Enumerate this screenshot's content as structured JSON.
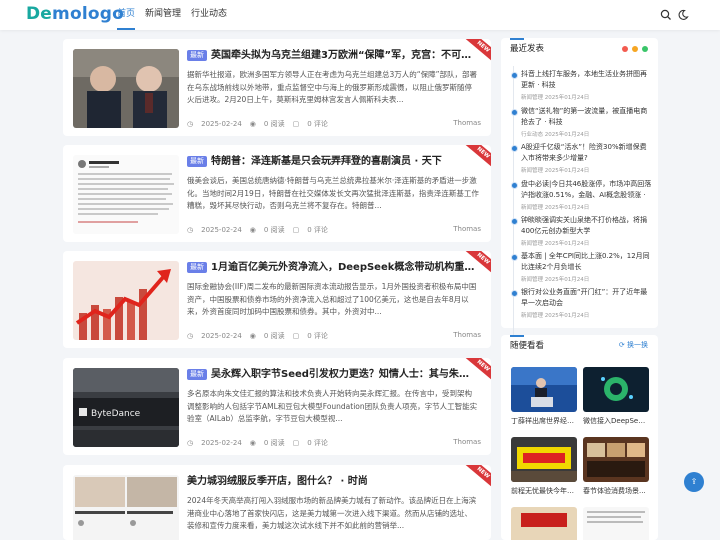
{
  "header": {
    "logo": {
      "part1": "De",
      "part2": "mologo"
    },
    "nav": [
      "首页",
      "新闻管理",
      "行业动态"
    ]
  },
  "posts": [
    {
      "badge": "最新",
      "title": "英国牵头拟为乌克兰组建3万欧洲“保障”军，克宫：不可接受 · 天下",
      "excerpt": "据新华社报道，欧洲多国军方领导人正在考虑为乌克兰组建总3万人的“保障”部队，部署在乌东战场前线以外地带，重点监督空中与海上的俄罗斯形成震慑，以阻止俄罗斯随停火后进攻。2月20日上午，莫斯科克里姆林宫发言人佩斯科夫表...",
      "date": "2025-02-24",
      "views": "0 阅读",
      "comments": "0 评论",
      "author": "Thomas",
      "ribbon": "NEW"
    },
    {
      "badge": "最新",
      "title": "特朗普：泽连斯基是只会玩弄拜登的喜剧演员 · 天下",
      "excerpt": "俄美会谈后，美国总统唐纳德·特朗普与乌克兰总统弗拉基米尔·泽连斯基的矛盾进一步激化。当地时间2月19日，特朗普在社交媒体发长文再次猛批泽连斯基，指责泽连斯基工作糟糕，毁坏其尽快行动，否则乌克兰将不复存在。特朗普...",
      "date": "2025-02-24",
      "views": "0 阅读",
      "comments": "0 评论",
      "author": "Thomas",
      "ribbon": "NEW"
    },
    {
      "badge": "最新",
      "title": "1月逾百亿美元外资净流入，DeepSeek概念带动机构重估中国市场 · 财经",
      "excerpt": "国际金融协会(IIF)周二发布的最新国际资本流动报告显示，1月外国投资者积极布局中国资产，中国股票和债券市场的外资净流入总和超过了100亿美元，这也是自去年8月以来，外资首度同时加码中国股票和债券。其中，外资对中...",
      "date": "2025-02-24",
      "views": "0 阅读",
      "comments": "0 评论",
      "author": "Thomas",
      "ribbon": "NEW"
    },
    {
      "badge": "最新",
      "title": "吴永辉入职字节Seed引发权力更迭？知情人士：其与朱文佳分工明确 · 科技",
      "excerpt": "多名原本向朱文佳汇报的算法和技术负责人开始转向吴永辉汇报。在传言中，受到架构调整影响的人包括字节AML和豆包大模型Foundation团队负责人项亮，字节人工智能实验室（AILab）总监李航，字节豆包大模型视...",
      "date": "2025-02-24",
      "views": "0 阅读",
      "comments": "0 评论",
      "author": "Thomas",
      "ribbon": "NEW"
    },
    {
      "badge": "",
      "title": "美力城羽绒服反季开店，图什么？ · 时尚",
      "excerpt": "2024年冬天高举高打闯入羽绒服市场的新品牌美力城有了新动作。该品牌近日在上海滨港商业中心落地了首家快闪店，这是美力城第一次进入线下渠道。然而从店铺的选址、装修和宣传力度来看，美力城这次试水线下并不如此前的营销举...",
      "date": "2025-02-24",
      "views": "0 阅读",
      "comments": "0 评论",
      "author": "Thomas",
      "ribbon": "NEW"
    }
  ],
  "sidebar": {
    "latest_title": "最近发表",
    "latest_dot_colors": [
      "#f35b4f",
      "#f6a623",
      "#3ac569"
    ],
    "latest": [
      {
        "text": "抖音上线打车服务，本地生活业务拼图再更新 · 科技",
        "cat": "新闻管理",
        "date": "2025年01月24日"
      },
      {
        "text": "微信“送礼物”的第一波流量，被直播电商抢去了 · 科技",
        "cat": "行业动态",
        "date": "2025年01月24日"
      },
      {
        "text": "A股迎千亿级“活水”！险资30%新增保费入市将带来多少增量?",
        "cat": "新闻管理",
        "date": "2025年01月24日"
      },
      {
        "text": "盘中必读|今日共46股涨停，市场冲高回落沪指收涨0.51%，金融、AI概念股领涨 · ...",
        "cat": "新闻管理",
        "date": "2025年01月24日"
      },
      {
        "text": "钟睒睒强调实关山泉绝不打价格战，将捐400亿元创办新型大学",
        "cat": "新闻管理",
        "date": "2025年01月24日"
      },
      {
        "text": "基本面 | 全年CPI同比上涨0.2%，12月同比连续2个月负增长",
        "cat": "新闻管理",
        "date": "2025年01月24日"
      },
      {
        "text": "银行对公业务直面“开门红”：开了近年最早一次启动会",
        "cat": "新闻管理",
        "date": "2025年01月24日"
      }
    ],
    "rec_title": "随便看看",
    "rec_more": "换一换",
    "rec": [
      {
        "title": "丁薛祥出席世界经济..."
      },
      {
        "title": "微信接入DeepSeek..."
      },
      {
        "title": "前程无忧最快今年上..."
      },
      {
        "title": "春节体验消费场景..."
      }
    ]
  }
}
